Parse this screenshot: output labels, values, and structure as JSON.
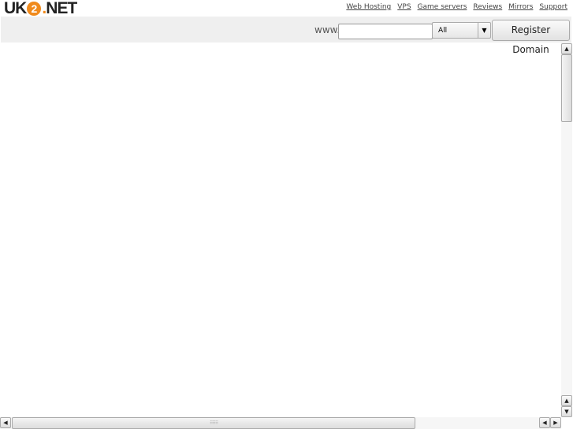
{
  "logo": {
    "text_a": "UK",
    "text_two": "2",
    "text_dot": ".",
    "text_b": "NET"
  },
  "nav": [
    "Web Hosting",
    "VPS",
    "Game servers",
    "Reviews",
    "Mirrors",
    "Support"
  ],
  "search": {
    "prefix": "www.",
    "value": "",
    "tld_selected": "All",
    "submit_label": "Register Domain"
  },
  "colors": {
    "brand": "#f08a1c",
    "bar": "#efefef"
  }
}
